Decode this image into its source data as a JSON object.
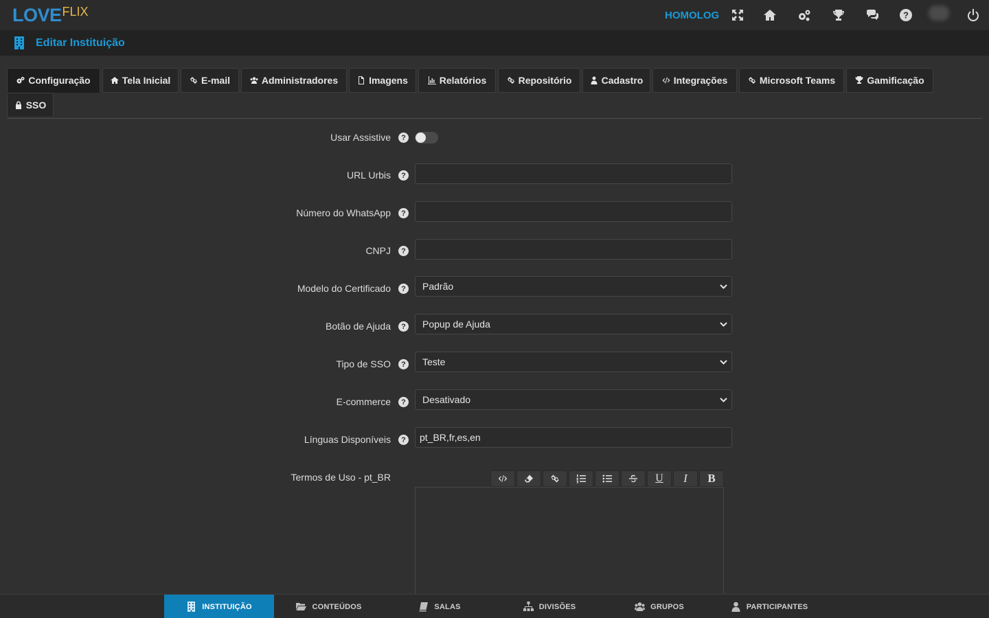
{
  "app": {
    "logo_love": "LOVE",
    "logo_flix": "FLIX",
    "environment": "HOMOLOG",
    "page_title": "Editar Instituição",
    "accent_color": "#1a9ad6"
  },
  "top_icons": [
    "fullscreen-icon",
    "home-icon",
    "settings-icon",
    "trophy-icon",
    "chat-icon",
    "help-icon",
    "avatar",
    "power-icon"
  ],
  "tabs": [
    {
      "label": "Configuração",
      "icon": "gears-icon"
    },
    {
      "label": "Tela Inicial",
      "icon": "home-icon"
    },
    {
      "label": "E-mail",
      "icon": "link-icon"
    },
    {
      "label": "Administradores",
      "icon": "users-icon"
    },
    {
      "label": "Imagens",
      "icon": "file-icon"
    },
    {
      "label": "Relatórios",
      "icon": "bar-chart-icon"
    },
    {
      "label": "Repositório",
      "icon": "link-icon"
    },
    {
      "label": "Cadastro",
      "icon": "user-icon"
    },
    {
      "label": "Integrações",
      "icon": "code-icon"
    },
    {
      "label": "Microsoft Teams",
      "icon": "link-icon"
    },
    {
      "label": "Gamificação",
      "icon": "trophy-icon"
    },
    {
      "label": "SSO",
      "icon": "lock-icon"
    }
  ],
  "form": {
    "usar_assistive": {
      "label": "Usar Assistive",
      "enabled": false
    },
    "url_urbis": {
      "label": "URL Urbis",
      "value": ""
    },
    "whatsapp": {
      "label": "Número do WhatsApp",
      "value": ""
    },
    "cnpj": {
      "label": "CNPJ",
      "value": ""
    },
    "modelo_certificado": {
      "label": "Modelo do Certificado",
      "value": "Padrão"
    },
    "botao_ajuda": {
      "label": "Botão de Ajuda",
      "value": "Popup de Ajuda"
    },
    "tipo_sso": {
      "label": "Tipo de SSO",
      "value": "Teste"
    },
    "ecommerce": {
      "label": "E-commerce",
      "value": "Desativado"
    },
    "linguas": {
      "label": "Línguas Disponíveis",
      "value": "pt_BR,fr,es,en"
    },
    "termos_uso": {
      "label": "Termos de Uso - pt_BR",
      "value": ""
    }
  },
  "editor_toolbar": [
    "code-view",
    "eraser",
    "link",
    "ordered-list",
    "unordered-list",
    "strikethrough",
    "underline",
    "italic",
    "bold"
  ],
  "editor_labels": {
    "underline": "U",
    "italic": "I",
    "bold": "B"
  },
  "bottom_nav": [
    {
      "label": "INSTITUIÇÃO",
      "icon": "building-icon",
      "active": true
    },
    {
      "label": "CONTEÚDOS",
      "icon": "folder-icon",
      "active": false
    },
    {
      "label": "SALAS",
      "icon": "book-icon",
      "active": false
    },
    {
      "label": "DIVISÕES",
      "icon": "sitemap-icon",
      "active": false
    },
    {
      "label": "GRUPOS",
      "icon": "users-icon",
      "active": false
    },
    {
      "label": "PARTICIPANTES",
      "icon": "user-icon",
      "active": false
    }
  ]
}
